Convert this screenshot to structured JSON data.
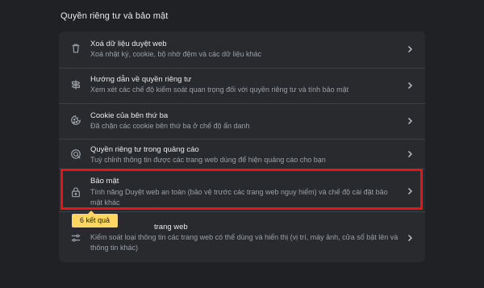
{
  "section": {
    "title": "Quyền riêng tư và bảo mật"
  },
  "rows": [
    {
      "icon": "trash-icon",
      "title": "Xoá dữ liệu duyệt web",
      "desc": "Xoá nhật ký, cookie, bộ nhớ đệm và các dữ liệu khác"
    },
    {
      "icon": "guide-icon",
      "title": "Hướng dẫn về quyền riêng tư",
      "desc": "Xem xét các chế độ kiểm soát quan trọng đối với quyền riêng tư và tính bảo mật"
    },
    {
      "icon": "cookie-icon",
      "title": "Cookie của bên thứ ba",
      "desc": "Đã chặn các cookie bên thứ ba ở chế độ ẩn danh"
    },
    {
      "icon": "ad-privacy-icon",
      "title": "Quyền riêng tư trong quảng cáo",
      "desc": "Tuỳ chỉnh thông tin được các trang web dùng để hiện quảng cáo cho bạn"
    },
    {
      "icon": "lock-icon",
      "title": "Bảo mật",
      "desc": "Tính năng Duyệt web an toàn (bảo vệ trước các trang web nguy hiểm) và chế độ cài đặt bảo mật khác"
    },
    {
      "icon": "tune-icon",
      "title": "Cài đặt trang web",
      "title_visible": "trang web",
      "desc": "Kiểm soát loại thông tin các trang web có thể dùng và hiển thị (vị trí, máy ảnh, cửa sổ bật lên và thông tin khác)"
    }
  ],
  "search_tooltip": "6 kết quả",
  "colors": {
    "background": "#202124",
    "card": "#292a2d",
    "highlight_border": "#e8141b",
    "tooltip_bg": "#fdd663"
  }
}
